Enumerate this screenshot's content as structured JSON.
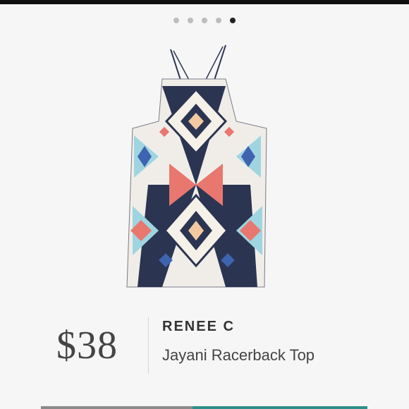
{
  "carousel": {
    "total": 5,
    "active_index": 4
  },
  "product": {
    "image_icon": "racerback-top-image",
    "price": "$38",
    "brand": "RENEE C",
    "name": "Jayani Racerback Top"
  },
  "colors": {
    "accent": "#2f8f8a",
    "text": "#444444",
    "background": "#f6f6f6"
  }
}
